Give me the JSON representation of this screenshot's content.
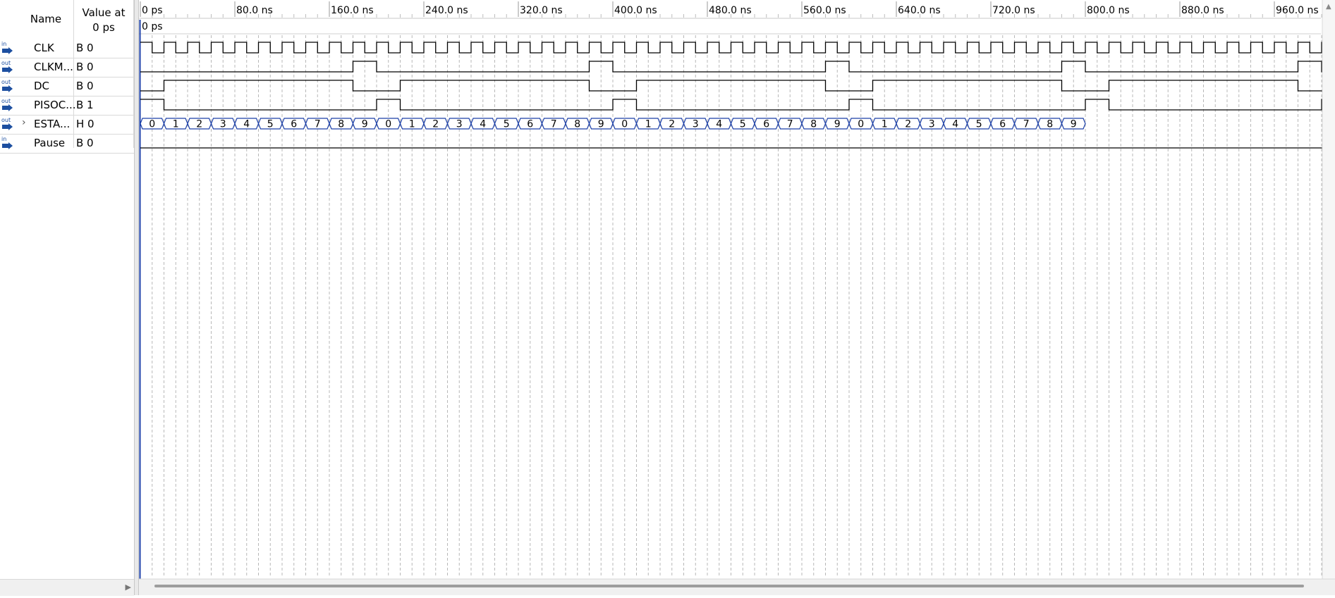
{
  "header": {
    "name_label": "Name",
    "value_label_line1": "Value at",
    "value_label_line2": "0 ps"
  },
  "cursor_label": "0 ps",
  "time_ticks": [
    "0 ps",
    "80.0 ns",
    "160.0 ns",
    "240.0 ns",
    "320.0 ns",
    "400.0 ns",
    "480.0 ns",
    "560.0 ns",
    "640.0 ns",
    "720.0 ns",
    "800.0 ns",
    "880.0 ns",
    "960.0 ns"
  ],
  "signals": [
    {
      "pin": "in",
      "name": "CLK",
      "value": "B 0",
      "expandable": false
    },
    {
      "pin": "out",
      "name": "CLKM...",
      "value": "B 0",
      "expandable": false
    },
    {
      "pin": "out",
      "name": "DC",
      "value": "B 0",
      "expandable": false
    },
    {
      "pin": "out",
      "name": "PISOC...",
      "value": "B 1",
      "expandable": false
    },
    {
      "pin": "out",
      "name": "ESTA...",
      "value": "H 0",
      "expandable": true
    },
    {
      "pin": "in",
      "name": "Pause",
      "value": "B 0",
      "expandable": false
    }
  ],
  "waveform": {
    "clock_period_ns": 20,
    "bus_sequence": [
      "0",
      "1",
      "2",
      "3",
      "4",
      "5",
      "6",
      "7",
      "8",
      "9",
      "0",
      "1",
      "2",
      "3",
      "4",
      "5",
      "6",
      "7",
      "8",
      "9",
      "0",
      "1",
      "2",
      "3",
      "4",
      "5",
      "6",
      "7",
      "8",
      "9",
      "0",
      "1",
      "2",
      "3",
      "4",
      "5",
      "6",
      "7",
      "8",
      "9"
    ],
    "colors": {
      "wave": "#000000",
      "bus": "#1b3fa8",
      "grid": "#b8b8b8",
      "pin_in": "#1d4fa0",
      "pin_out": "#1d4fa0"
    }
  }
}
